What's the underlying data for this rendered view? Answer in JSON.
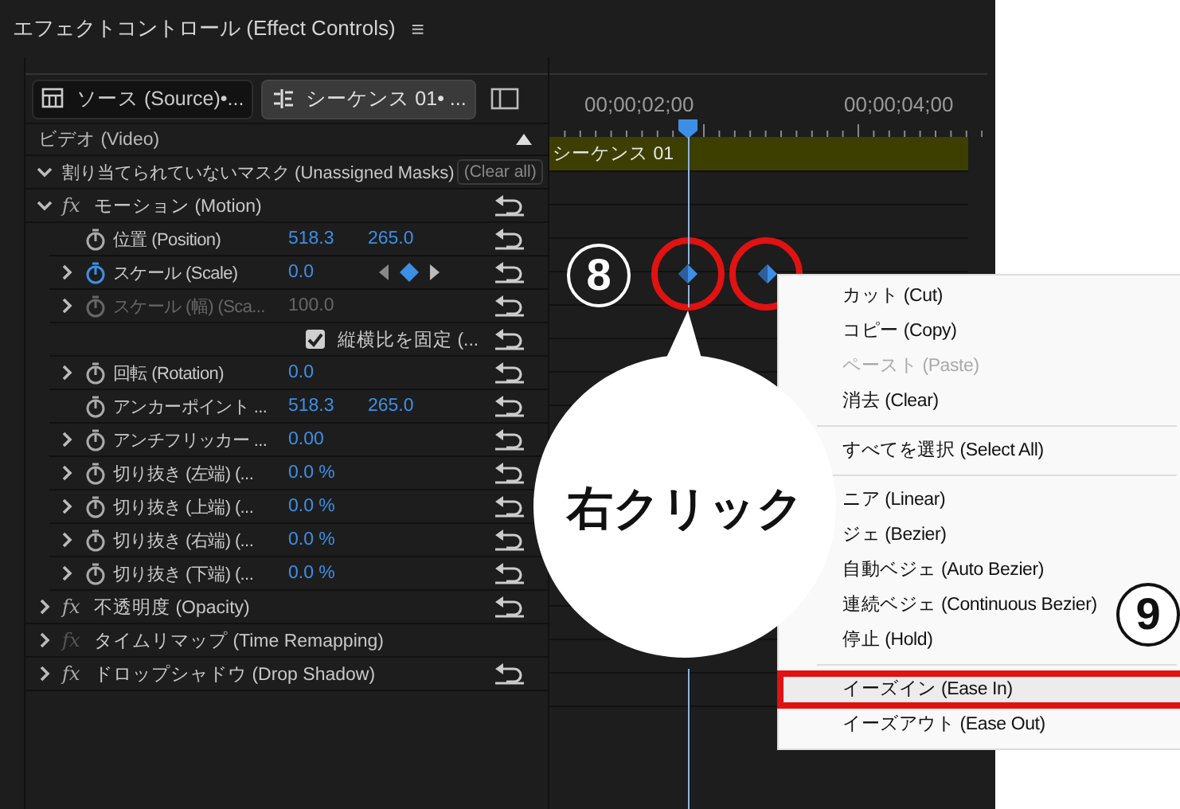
{
  "window": {
    "title": "エフェクトコントロール (Effect Controls)",
    "menu_icon": "≡"
  },
  "tabs": [
    {
      "label": "ソース (Source)•...",
      "selected": false,
      "kind": "clip"
    },
    {
      "label": "シーケンス 01• ...",
      "selected": true,
      "kind": "sequence"
    }
  ],
  "section": {
    "label": "ビデオ (Video)"
  },
  "rows": [
    {
      "kind": "mask",
      "label": "割り当てられていないマスク (Unassigned Masks)",
      "button": "(Clear all)",
      "expanded": true
    },
    {
      "kind": "effect",
      "label": "モーション (Motion)",
      "fx": "fx",
      "expanded": true,
      "fx_enabled": true,
      "reset": true
    },
    {
      "kind": "property",
      "label": "位置 (Position)",
      "values": [
        "518.3",
        "265.0"
      ],
      "expandable": false,
      "animated": false,
      "disabled": false,
      "reset": true
    },
    {
      "kind": "property",
      "label": "スケール (Scale)",
      "values": [
        "0.0"
      ],
      "expandable": true,
      "animated": true,
      "disabled": false,
      "reset": true,
      "keyframe_nav": true
    },
    {
      "kind": "property",
      "label": "スケール (幅) (Sca...",
      "values": [
        "100.0"
      ],
      "expandable": true,
      "animated": false,
      "disabled": true,
      "reset": true
    },
    {
      "kind": "checkbox",
      "label": "縦横比を固定 (...",
      "checked": true,
      "reset": true
    },
    {
      "kind": "property",
      "label": "回転 (Rotation)",
      "values": [
        "0.0"
      ],
      "expandable": true,
      "animated": false,
      "disabled": false,
      "reset": true
    },
    {
      "kind": "property",
      "label": "アンカーポイント ...",
      "values": [
        "518.3",
        "265.0"
      ],
      "expandable": false,
      "animated": false,
      "disabled": false,
      "reset": true
    },
    {
      "kind": "property",
      "label": "アンチフリッカー ...",
      "values": [
        "0.00"
      ],
      "expandable": true,
      "animated": false,
      "disabled": false,
      "reset": true
    },
    {
      "kind": "property",
      "label": "切り抜き (左端) (...",
      "values": [
        "0.0 %"
      ],
      "expandable": true,
      "animated": false,
      "disabled": false,
      "reset": true
    },
    {
      "kind": "property",
      "label": "切り抜き (上端) (...",
      "values": [
        "0.0 %"
      ],
      "expandable": true,
      "animated": false,
      "disabled": false,
      "reset": true
    },
    {
      "kind": "property",
      "label": "切り抜き (右端) (...",
      "values": [
        "0.0 %"
      ],
      "expandable": true,
      "animated": false,
      "disabled": false,
      "reset": true
    },
    {
      "kind": "property",
      "label": "切り抜き (下端) (...",
      "values": [
        "0.0 %"
      ],
      "expandable": true,
      "animated": false,
      "disabled": false,
      "reset": true
    },
    {
      "kind": "effect",
      "label": "不透明度 (Opacity)",
      "fx": "fx",
      "expanded": false,
      "fx_enabled": true,
      "reset": true
    },
    {
      "kind": "effect",
      "label": "タイムリマップ (Time Remapping)",
      "fx": "fx",
      "expanded": false,
      "fx_enabled": false,
      "reset": false
    },
    {
      "kind": "effect",
      "label": "ドロップシャドウ (Drop Shadow)",
      "fx": "fx",
      "expanded": false,
      "fx_enabled": true,
      "reset": true
    }
  ],
  "timeline": {
    "timecodes": [
      "00;00;02;00",
      "00;00;04;00"
    ],
    "clip": "シーケンス 01"
  },
  "context_menu": [
    {
      "kind": "item",
      "label": "カット (Cut)",
      "disabled": false,
      "selected": false
    },
    {
      "kind": "item",
      "label": "コピー (Copy)",
      "disabled": false,
      "selected": false
    },
    {
      "kind": "item",
      "label": "ペースト (Paste)",
      "disabled": true,
      "selected": false
    },
    {
      "kind": "item",
      "label": "消去 (Clear)",
      "disabled": false,
      "selected": false
    },
    {
      "kind": "separator"
    },
    {
      "kind": "item",
      "label": "すべてを選択 (Select All)",
      "disabled": false,
      "selected": false
    },
    {
      "kind": "separator"
    },
    {
      "kind": "item",
      "label": "ニア (Linear)",
      "disabled": false,
      "selected": false
    },
    {
      "kind": "item",
      "label": "ジェ (Bezier)",
      "disabled": false,
      "selected": false
    },
    {
      "kind": "item",
      "label": "自動ベジェ (Auto Bezier)",
      "disabled": false,
      "selected": false
    },
    {
      "kind": "item",
      "label": "連続ベジェ (Continuous Bezier)",
      "disabled": false,
      "selected": false
    },
    {
      "kind": "item",
      "label": "停止 (Hold)",
      "disabled": false,
      "selected": false
    },
    {
      "kind": "separator"
    },
    {
      "kind": "item",
      "label": "イーズイン (Ease In)",
      "disabled": false,
      "selected": true
    },
    {
      "kind": "item",
      "label": "イーズアウト (Ease Out)",
      "disabled": false,
      "selected": false
    }
  ],
  "annotations": {
    "step_a": "8",
    "step_b": "9",
    "callout": "右クリック"
  }
}
